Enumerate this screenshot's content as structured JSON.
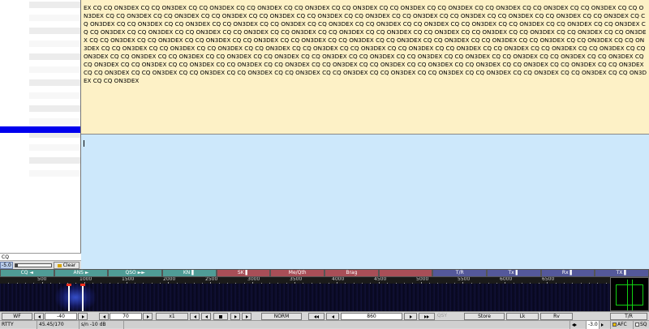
{
  "rx_text": "EX CQ CQ ON3DEX CQ CQ ON3DEX CQ CQ ON3DEX CQ CQ ON3DEX CQ CQ ON3DEX CQ CQ ON3DEX CQ CQ ON3DEX CQ CQ ON3DEX CQ CQ ON3DEX CQ CQ ON3DEX CQ CQ ON3DEX CQ CQ ON3DEX CQ CQ ON3DEX CQ CQ ON3DEX CQ CQ ON3DEX CQ CQ ON3DEX CQ CQ ON3DEX CQ CQ ON3DEX CQ CQ ON3DEX CQ CQ ON3DEX CQ CQ ON3DEX CQ CQ ON3DEX CQ CQ ON3DEX CQ CQ ON3DEX CQ CQ ON3DEX CQ CQ ON3DEX CQ CQ ON3DEX CQ CQ ON3DEX CQ CQ ON3DEX CQ CQ ON3DEX CQ CQ ON3DEX CQ CQ ON3DEX CQ CQ ON3DEX CQ CQ ON3DEX CQ CQ ON3DEX CQ CQ ON3DEX CQ CQ ON3DEX CQ CQ ON3DEX CQ CQ ON3DEX CQ CQ ON3DEX CQ CQ ON3DEX CQ CQ ON3DEX CQ CQ ON3DEX CQ CQ ON3DEX CQ CQ ON3DEX CQ CQ ON3DEX CQ CQ ON3DEX CQ CQ ON3DEX CQ CQ ON3DEX CQ CQ ON3DEX CQ CQ ON3DEX CQ CQ ON3DEX CQ CQ ON3DEX CQ CQ ON3DEX CQ CQ ON3DEX CQ CQ ON3DEX CQ CQ ON3DEX CQ CQ ON3DEX CQ CQ ON3DEX CQ CQ ON3DEX CQ CQ ON3DEX CQ CQ ON3DEX CQ CQ ON3DEX CQ CQ ON3DEX CQ CQ ON3DEX CQ CQ ON3DEX CQ CQ ON3DEX CQ CQ ON3DEX CQ CQ ON3DEX CQ CQ ON3DEX CQ CQ ON3DEX CQ CQ ON3DEX CQ CQ ON3DEX CQ CQ ON3DEX CQ CQ ON3DEX CQ CQ ON3DEX CQ CQ ON3DEX CQ CQ ON3DEX CQ CQ ON3DEX CQ CQ ON3DEX CQ CQ ON3DEX CQ CQ ON3DEX CQ CQ ON3DEX CQ CQ ON3DEX CQ CQ ON3DEX CQ CQ ON3DEX CQ CQ ON3DEX CQ CQ ON3DEX CQ CQ ON3DEX CQ CQ ON3DEX CQ CQ ON3DEX CQ CQ ON3DEX CQ CQ ON3DEX CQ CQ ON3DEX CQ CQ ON3DEX CQ CQ ON3DEX CQ CQ ON3DEX CQ CQ ON3DEX CQ CQ ON3DEX CQ CQ ON3DEX CQ CQ ON3DEX CQ CQ ON3DEX CQ CQ ON3DEX CQ CQ ON3DEX CQ CQ ON3DEX CQ CQ ON3DEX CQ CQ ON3DEX",
  "left_panel": {
    "search_value": "CQ",
    "squelch_value": "-5.0",
    "clear_label": "Clear"
  },
  "macros": [
    {
      "label": "CQ ◄",
      "color": "t"
    },
    {
      "label": "ANS ►",
      "color": "t"
    },
    {
      "label": "QSO ►►",
      "color": "t"
    },
    {
      "label": "KN ▌",
      "color": "t"
    },
    {
      "label": "SK ▌",
      "color": "r"
    },
    {
      "label": "Me/Qth",
      "color": "r"
    },
    {
      "label": "Brag",
      "color": "r"
    },
    {
      "label": "",
      "color": "r"
    },
    {
      "label": "T/R",
      "color": "b"
    },
    {
      "label": "Tx ▌",
      "color": "b"
    },
    {
      "label": "Rx ▌",
      "color": "b"
    },
    {
      "label": "TX ▌",
      "color": "b"
    }
  ],
  "scale_ticks": [
    "500",
    "1000",
    "1500",
    "2000",
    "2500",
    "3000",
    "3500",
    "4000",
    "4500",
    "5000",
    "5500",
    "6000",
    "6500"
  ],
  "controls": {
    "wf_label": "WF",
    "ref_level": "-40",
    "range": "70",
    "zoom": "x1",
    "mode": "NORM",
    "freq": "860",
    "qsy": "QSY",
    "store": "Store",
    "lk": "Lk",
    "rv": "Rv",
    "tr": "T/R"
  },
  "status": {
    "mode": "RTTY",
    "rate": "45.45/170",
    "sn": "s/n -10 dB",
    "afc_value": "-3.0",
    "afc_label": "AFC",
    "sql_label": "SQ"
  }
}
